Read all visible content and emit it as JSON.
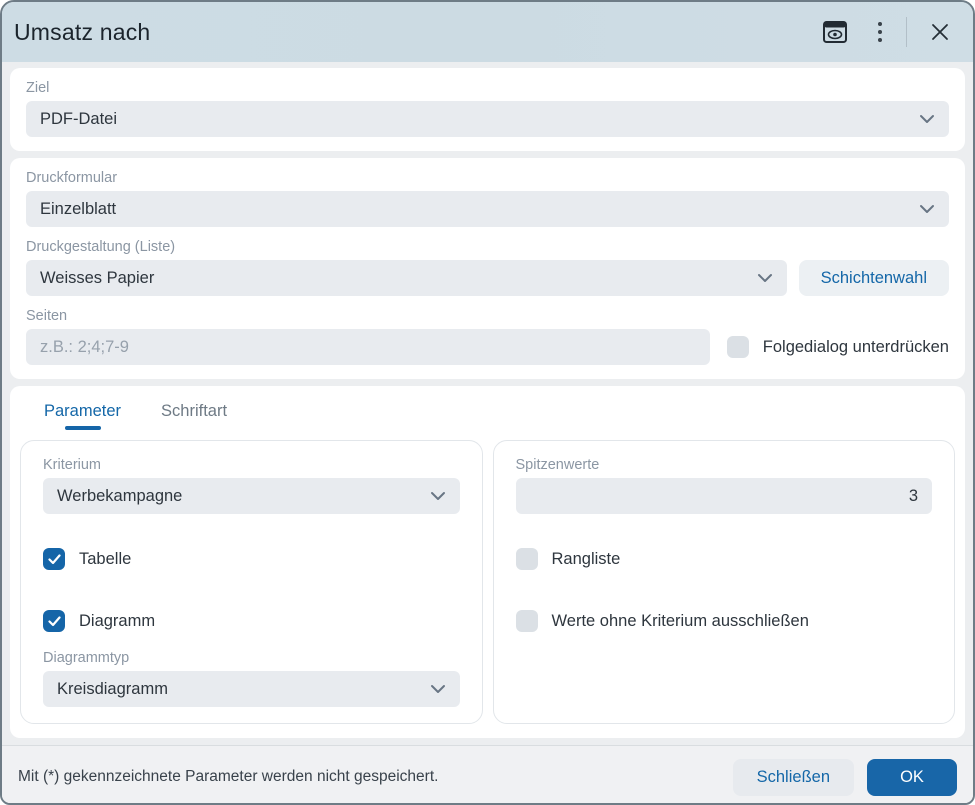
{
  "window": {
    "title": "Umsatz nach"
  },
  "target_section": {
    "ziel_label": "Ziel",
    "ziel_value": "PDF-Datei"
  },
  "print_section": {
    "druckformular_label": "Druckformular",
    "druckformular_value": "Einzelblatt",
    "druckgestaltung_label": "Druckgestaltung (Liste)",
    "druckgestaltung_value": "Weisses Papier",
    "schichtenwahl_button": "Schichtenwahl",
    "seiten_label": "Seiten",
    "seiten_placeholder": "z.B.: 2;4;7-9",
    "seiten_value": "",
    "folgedialog_label": "Folgedialog unterdrücken",
    "folgedialog_checked": false
  },
  "tabs": [
    {
      "label": "Parameter"
    },
    {
      "label": "Schriftart"
    }
  ],
  "parameter_tab": {
    "left": {
      "kriterium_label": "Kriterium",
      "kriterium_value": "Werbekampagne",
      "tabelle_label": "Tabelle",
      "tabelle_checked": true,
      "diagramm_label": "Diagramm",
      "diagramm_checked": true,
      "diagrammtyp_label": "Diagrammtyp",
      "diagrammtyp_value": "Kreisdiagramm"
    },
    "right": {
      "spitzenwerte_label": "Spitzenwerte",
      "spitzenwerte_value": "3",
      "rangliste_label": "Rangliste",
      "rangliste_checked": false,
      "werte_label": "Werte ohne Kriterium ausschließen",
      "werte_checked": false
    }
  },
  "footer": {
    "note": "Mit (*) gekennzeichnete Parameter werden nicht gespeichert.",
    "close_button": "Schließen",
    "ok_button": "OK"
  },
  "colors": {
    "accent_blue": "#1565a8",
    "titlebar_bg": "#cddce4",
    "input_bg": "#e8ebef",
    "page_bg": "#eceef0"
  }
}
